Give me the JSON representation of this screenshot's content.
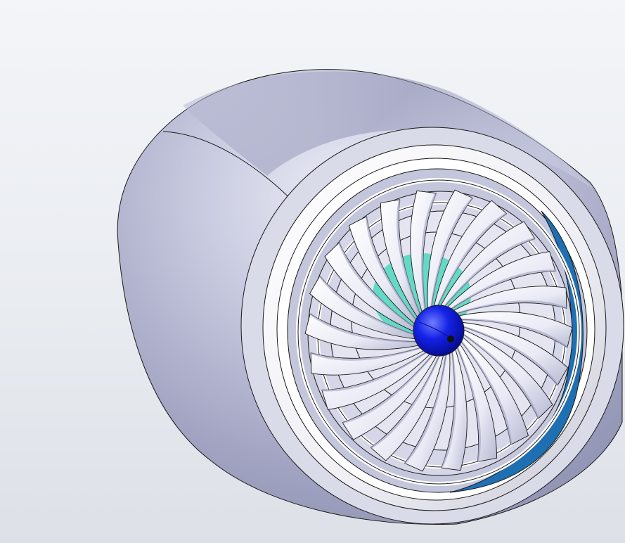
{
  "viewport": {
    "background_top": "#f3f5f8",
    "background_bottom": "#dde1e7"
  },
  "model": {
    "fan_blade_count": 22,
    "colors": {
      "nacelle": "#a9abc7",
      "nacelle_highlight": "#e4e6f2",
      "nacelle_shadow": "#7e80a3",
      "inlet_lip": "#f4f4f8",
      "blade": "#f1f2fa",
      "blade_shadow": "#a8abc8",
      "spinner": "#0b14d6",
      "spinner_highlight": "#6f7dff",
      "bypass_duct": "#1f6fb3",
      "core_accent": "#38d6b8",
      "edge_line": "#1a1a1a"
    }
  }
}
